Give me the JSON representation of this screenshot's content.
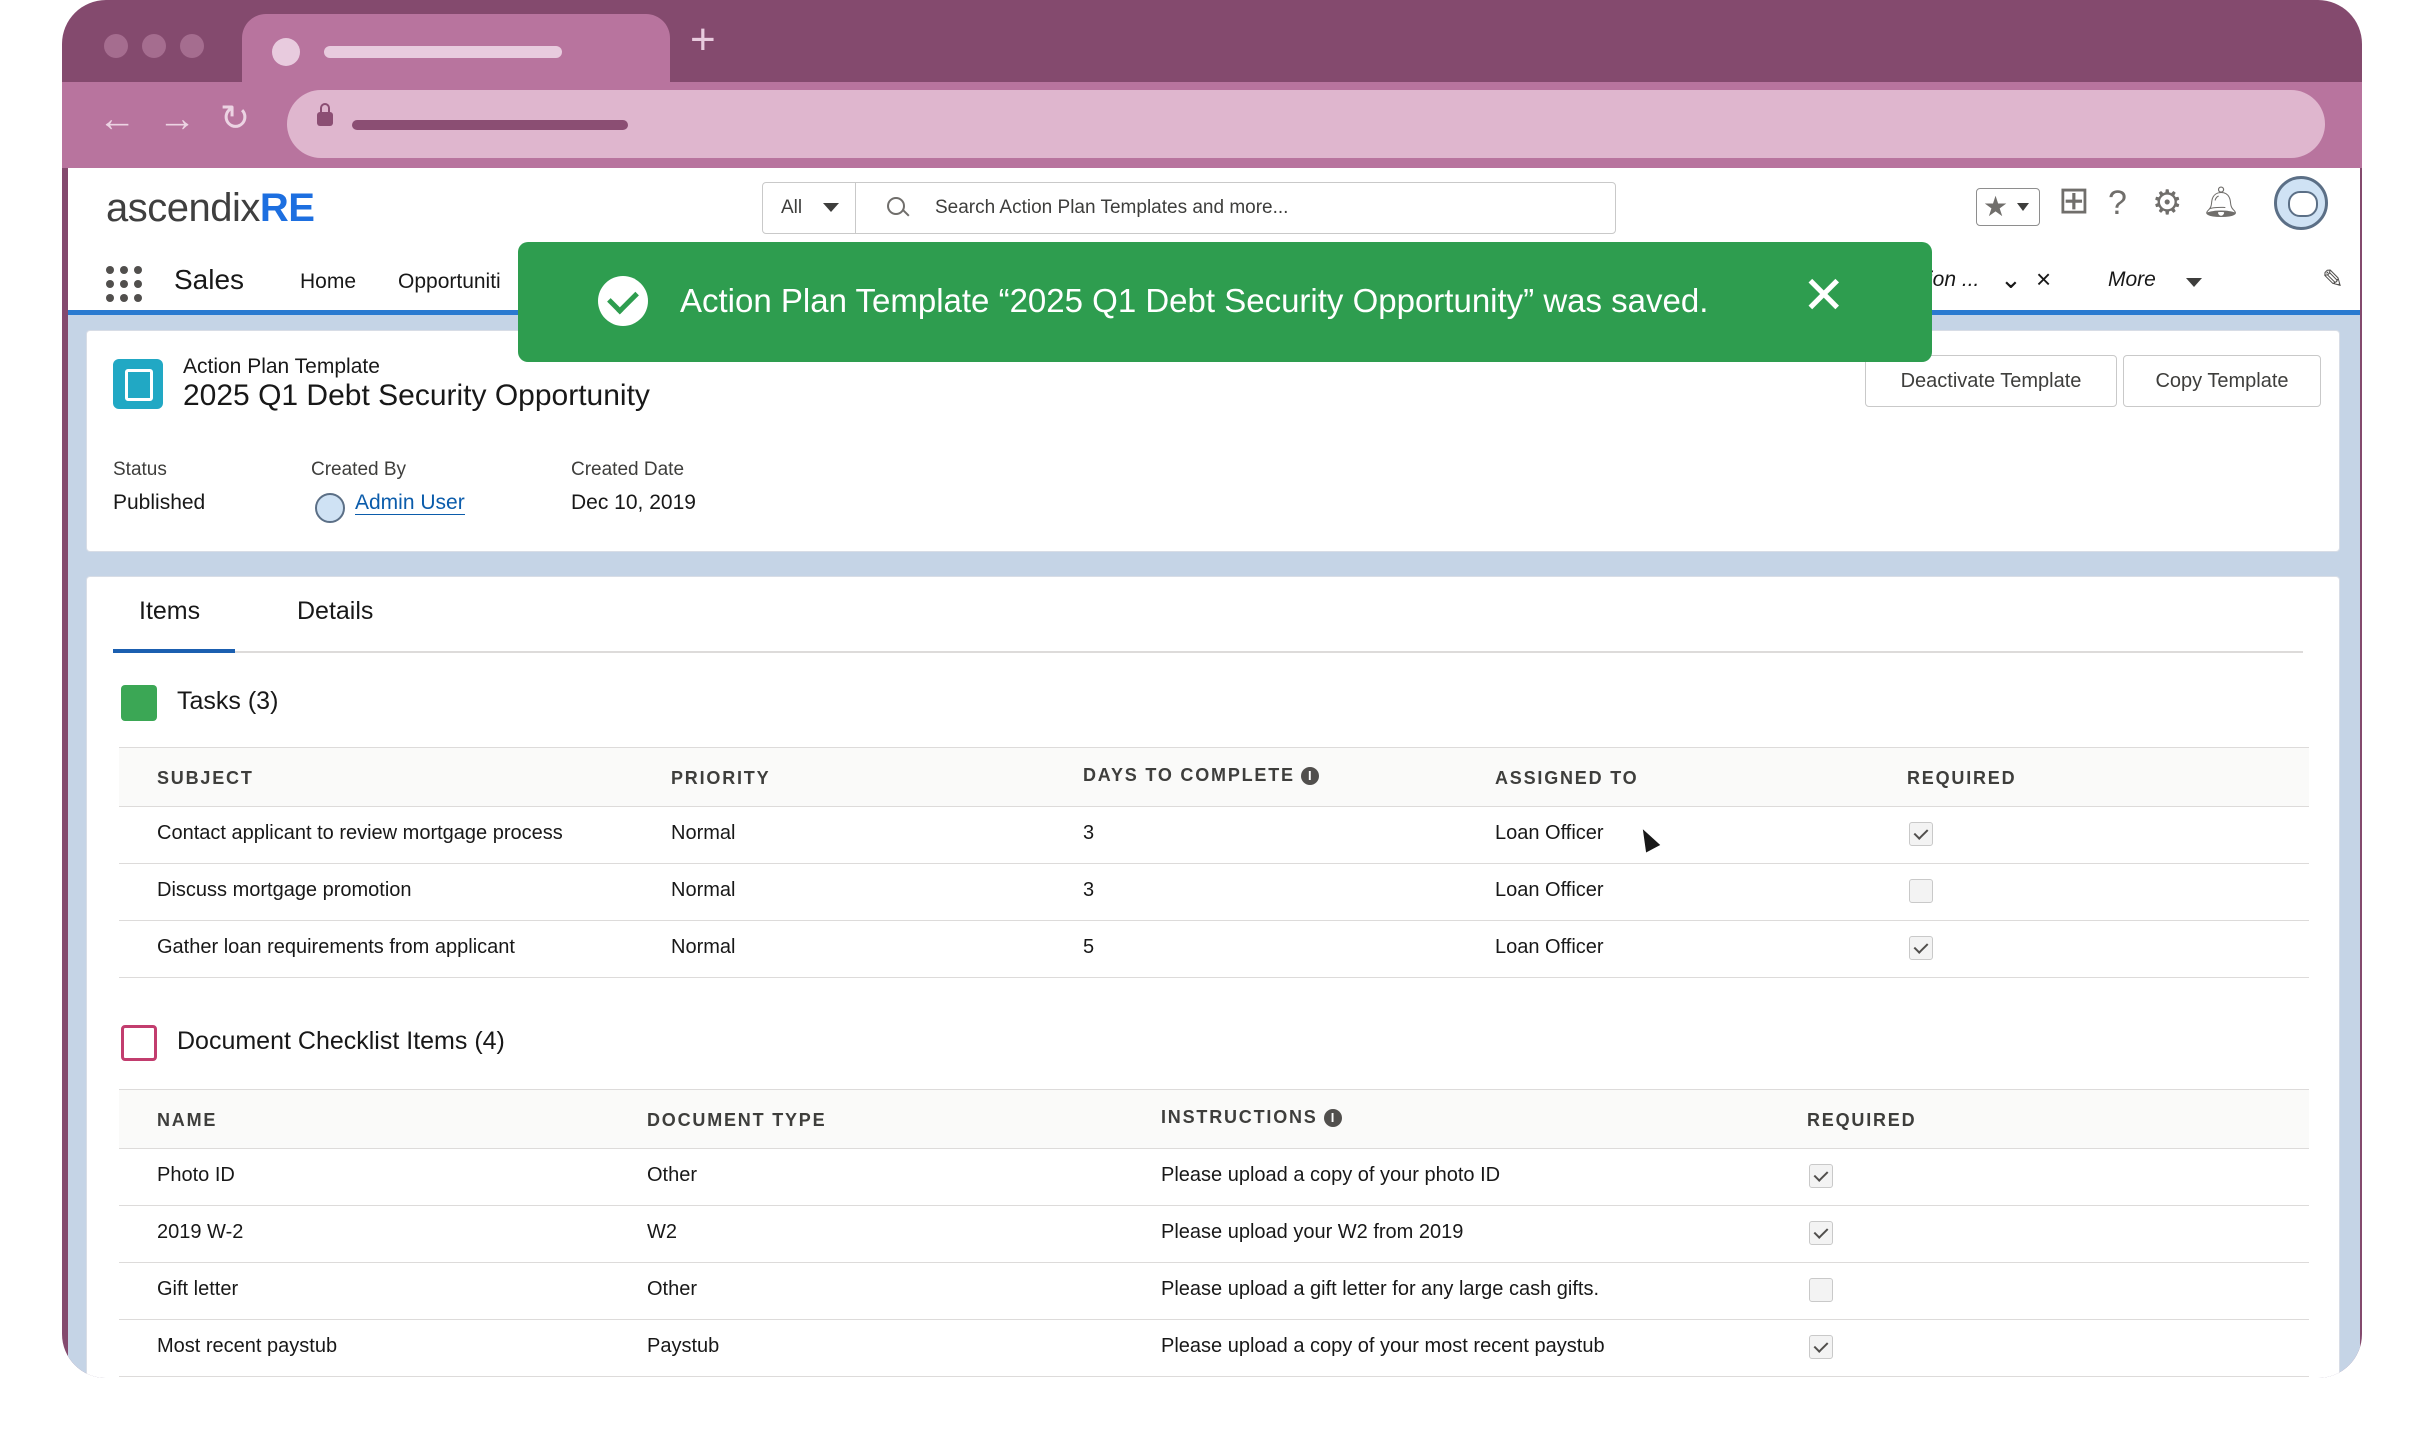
{
  "header": {
    "logo_text": "ascendix",
    "logo_accent": "RE",
    "search_scope": "All",
    "search_placeholder": "Search Action Plan Templates and more..."
  },
  "navbar": {
    "app_name": "Sales",
    "items": [
      "Home",
      "Opportuniti"
    ],
    "overflow_tab_label": "ion ...",
    "more_label": "More"
  },
  "toast": {
    "message": "Action Plan Template “2025 Q1 Debt Security Opportunity” was saved."
  },
  "record": {
    "object_type": "Action Plan Template",
    "title": "2025 Q1 Debt Security Opportunity",
    "buttons": {
      "deactivate": "Deactivate Template",
      "copy": "Copy Template"
    },
    "fields": {
      "status_label": "Status",
      "status_value": "Published",
      "created_by_label": "Created By",
      "created_by_value": "Admin User",
      "created_date_label": "Created Date",
      "created_date_value": "Dec 10, 2019"
    }
  },
  "tabs": [
    "Items",
    "Details"
  ],
  "tasks": {
    "title": "Tasks (3)",
    "columns": [
      "Subject",
      "Priority",
      "Days to Complete",
      "Assigned To",
      "Required"
    ],
    "rows": [
      {
        "subject": "Contact applicant to review mortgage process",
        "priority": "Normal",
        "days": "3",
        "assigned": "Loan Officer",
        "required": true
      },
      {
        "subject": "Discuss mortgage promotion",
        "priority": "Normal",
        "days": "3",
        "assigned": "Loan Officer",
        "required": false
      },
      {
        "subject": "Gather loan requirements from applicant",
        "priority": "Normal",
        "days": "5",
        "assigned": "Loan Officer",
        "required": true
      }
    ]
  },
  "documents": {
    "title": "Document Checklist Items (4)",
    "columns": [
      "Name",
      "Document Type",
      "Instructions",
      "Required"
    ],
    "rows": [
      {
        "name": "Photo ID",
        "type": "Other",
        "instructions": "Please upload a copy of your photo ID",
        "required": true
      },
      {
        "name": "2019 W-2",
        "type": "W2",
        "instructions": "Please upload your W2 from 2019",
        "required": true
      },
      {
        "name": "Gift letter",
        "type": "Other",
        "instructions": "Please upload a gift letter for any large cash gifts.",
        "required": false
      },
      {
        "name": "Most recent paystub",
        "type": "Paystub",
        "instructions": "Please upload a copy of your most recent paystub",
        "required": true
      }
    ]
  },
  "colors": {
    "browser_frame": "#844a6e",
    "toast_green": "#2e9d4f",
    "brand_blue": "#1d6fe0",
    "link_blue": "#0b5cab"
  }
}
